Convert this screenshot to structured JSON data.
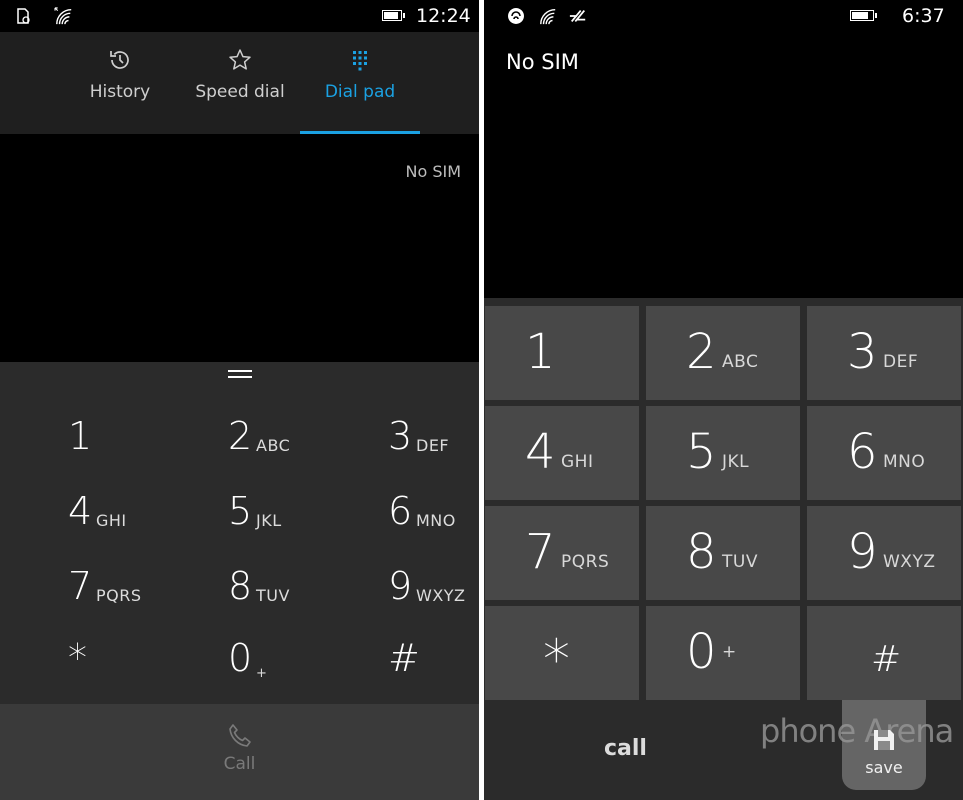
{
  "left": {
    "status": {
      "time": "12:24",
      "icons": [
        "notification-icon",
        "signal-weak-icon",
        "wifi-icon",
        "battery-icon"
      ]
    },
    "tabs": [
      {
        "label": "History",
        "icon": "history-icon",
        "active": false
      },
      {
        "label": "Speed dial",
        "icon": "star-icon",
        "active": false
      },
      {
        "label": "Dial pad",
        "icon": "dialpad-icon",
        "active": true
      }
    ],
    "sim_status": "No SIM",
    "keys": [
      {
        "digit": "1",
        "sub": ""
      },
      {
        "digit": "2",
        "sub": "ABC"
      },
      {
        "digit": "3",
        "sub": "DEF"
      },
      {
        "digit": "4",
        "sub": "GHI"
      },
      {
        "digit": "5",
        "sub": "JKL"
      },
      {
        "digit": "6",
        "sub": "MNO"
      },
      {
        "digit": "7",
        "sub": "PQRS"
      },
      {
        "digit": "8",
        "sub": "TUV"
      },
      {
        "digit": "9",
        "sub": "WXYZ"
      },
      {
        "digit": "*",
        "sub": ""
      },
      {
        "digit": "0",
        "sub": "+"
      },
      {
        "digit": "#",
        "sub": ""
      }
    ],
    "call_label": "Call",
    "accent": "#1ba1e2"
  },
  "right": {
    "status": {
      "time": "6:37",
      "icons": [
        "nfc-icon",
        "wifi-icon",
        "data-icon",
        "battery-icon"
      ]
    },
    "sim_status": "No SIM",
    "keys": [
      {
        "digit": "1",
        "sub": ""
      },
      {
        "digit": "2",
        "sub": "ABC"
      },
      {
        "digit": "3",
        "sub": "DEF"
      },
      {
        "digit": "4",
        "sub": "GHI"
      },
      {
        "digit": "5",
        "sub": "JKL"
      },
      {
        "digit": "6",
        "sub": "MNO"
      },
      {
        "digit": "7",
        "sub": "PQRS"
      },
      {
        "digit": "8",
        "sub": "TUV"
      },
      {
        "digit": "9",
        "sub": "WXYZ"
      },
      {
        "digit": "*",
        "sub": ""
      },
      {
        "digit": "0",
        "sub": "+"
      },
      {
        "digit": "#",
        "sub": ""
      }
    ],
    "call_label": "call",
    "save_label": "save",
    "watermark": "phone Arena"
  }
}
